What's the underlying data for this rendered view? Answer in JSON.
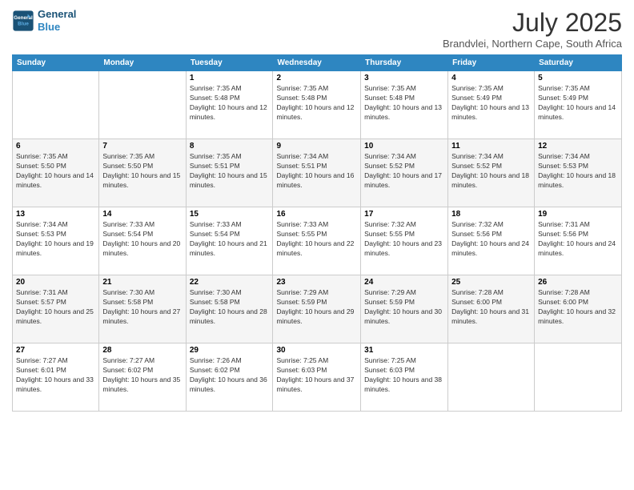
{
  "header": {
    "logo_line1": "General",
    "logo_line2": "Blue",
    "month_title": "July 2025",
    "location": "Brandvlei, Northern Cape, South Africa"
  },
  "weekdays": [
    "Sunday",
    "Monday",
    "Tuesday",
    "Wednesday",
    "Thursday",
    "Friday",
    "Saturday"
  ],
  "weeks": [
    [
      {
        "day": null
      },
      {
        "day": null
      },
      {
        "day": "1",
        "sunrise": "Sunrise: 7:35 AM",
        "sunset": "Sunset: 5:48 PM",
        "daylight": "Daylight: 10 hours and 12 minutes."
      },
      {
        "day": "2",
        "sunrise": "Sunrise: 7:35 AM",
        "sunset": "Sunset: 5:48 PM",
        "daylight": "Daylight: 10 hours and 12 minutes."
      },
      {
        "day": "3",
        "sunrise": "Sunrise: 7:35 AM",
        "sunset": "Sunset: 5:48 PM",
        "daylight": "Daylight: 10 hours and 13 minutes."
      },
      {
        "day": "4",
        "sunrise": "Sunrise: 7:35 AM",
        "sunset": "Sunset: 5:49 PM",
        "daylight": "Daylight: 10 hours and 13 minutes."
      },
      {
        "day": "5",
        "sunrise": "Sunrise: 7:35 AM",
        "sunset": "Sunset: 5:49 PM",
        "daylight": "Daylight: 10 hours and 14 minutes."
      }
    ],
    [
      {
        "day": "6",
        "sunrise": "Sunrise: 7:35 AM",
        "sunset": "Sunset: 5:50 PM",
        "daylight": "Daylight: 10 hours and 14 minutes."
      },
      {
        "day": "7",
        "sunrise": "Sunrise: 7:35 AM",
        "sunset": "Sunset: 5:50 PM",
        "daylight": "Daylight: 10 hours and 15 minutes."
      },
      {
        "day": "8",
        "sunrise": "Sunrise: 7:35 AM",
        "sunset": "Sunset: 5:51 PM",
        "daylight": "Daylight: 10 hours and 15 minutes."
      },
      {
        "day": "9",
        "sunrise": "Sunrise: 7:34 AM",
        "sunset": "Sunset: 5:51 PM",
        "daylight": "Daylight: 10 hours and 16 minutes."
      },
      {
        "day": "10",
        "sunrise": "Sunrise: 7:34 AM",
        "sunset": "Sunset: 5:52 PM",
        "daylight": "Daylight: 10 hours and 17 minutes."
      },
      {
        "day": "11",
        "sunrise": "Sunrise: 7:34 AM",
        "sunset": "Sunset: 5:52 PM",
        "daylight": "Daylight: 10 hours and 18 minutes."
      },
      {
        "day": "12",
        "sunrise": "Sunrise: 7:34 AM",
        "sunset": "Sunset: 5:53 PM",
        "daylight": "Daylight: 10 hours and 18 minutes."
      }
    ],
    [
      {
        "day": "13",
        "sunrise": "Sunrise: 7:34 AM",
        "sunset": "Sunset: 5:53 PM",
        "daylight": "Daylight: 10 hours and 19 minutes."
      },
      {
        "day": "14",
        "sunrise": "Sunrise: 7:33 AM",
        "sunset": "Sunset: 5:54 PM",
        "daylight": "Daylight: 10 hours and 20 minutes."
      },
      {
        "day": "15",
        "sunrise": "Sunrise: 7:33 AM",
        "sunset": "Sunset: 5:54 PM",
        "daylight": "Daylight: 10 hours and 21 minutes."
      },
      {
        "day": "16",
        "sunrise": "Sunrise: 7:33 AM",
        "sunset": "Sunset: 5:55 PM",
        "daylight": "Daylight: 10 hours and 22 minutes."
      },
      {
        "day": "17",
        "sunrise": "Sunrise: 7:32 AM",
        "sunset": "Sunset: 5:55 PM",
        "daylight": "Daylight: 10 hours and 23 minutes."
      },
      {
        "day": "18",
        "sunrise": "Sunrise: 7:32 AM",
        "sunset": "Sunset: 5:56 PM",
        "daylight": "Daylight: 10 hours and 24 minutes."
      },
      {
        "day": "19",
        "sunrise": "Sunrise: 7:31 AM",
        "sunset": "Sunset: 5:56 PM",
        "daylight": "Daylight: 10 hours and 24 minutes."
      }
    ],
    [
      {
        "day": "20",
        "sunrise": "Sunrise: 7:31 AM",
        "sunset": "Sunset: 5:57 PM",
        "daylight": "Daylight: 10 hours and 25 minutes."
      },
      {
        "day": "21",
        "sunrise": "Sunrise: 7:30 AM",
        "sunset": "Sunset: 5:58 PM",
        "daylight": "Daylight: 10 hours and 27 minutes."
      },
      {
        "day": "22",
        "sunrise": "Sunrise: 7:30 AM",
        "sunset": "Sunset: 5:58 PM",
        "daylight": "Daylight: 10 hours and 28 minutes."
      },
      {
        "day": "23",
        "sunrise": "Sunrise: 7:29 AM",
        "sunset": "Sunset: 5:59 PM",
        "daylight": "Daylight: 10 hours and 29 minutes."
      },
      {
        "day": "24",
        "sunrise": "Sunrise: 7:29 AM",
        "sunset": "Sunset: 5:59 PM",
        "daylight": "Daylight: 10 hours and 30 minutes."
      },
      {
        "day": "25",
        "sunrise": "Sunrise: 7:28 AM",
        "sunset": "Sunset: 6:00 PM",
        "daylight": "Daylight: 10 hours and 31 minutes."
      },
      {
        "day": "26",
        "sunrise": "Sunrise: 7:28 AM",
        "sunset": "Sunset: 6:00 PM",
        "daylight": "Daylight: 10 hours and 32 minutes."
      }
    ],
    [
      {
        "day": "27",
        "sunrise": "Sunrise: 7:27 AM",
        "sunset": "Sunset: 6:01 PM",
        "daylight": "Daylight: 10 hours and 33 minutes."
      },
      {
        "day": "28",
        "sunrise": "Sunrise: 7:27 AM",
        "sunset": "Sunset: 6:02 PM",
        "daylight": "Daylight: 10 hours and 35 minutes."
      },
      {
        "day": "29",
        "sunrise": "Sunrise: 7:26 AM",
        "sunset": "Sunset: 6:02 PM",
        "daylight": "Daylight: 10 hours and 36 minutes."
      },
      {
        "day": "30",
        "sunrise": "Sunrise: 7:25 AM",
        "sunset": "Sunset: 6:03 PM",
        "daylight": "Daylight: 10 hours and 37 minutes."
      },
      {
        "day": "31",
        "sunrise": "Sunrise: 7:25 AM",
        "sunset": "Sunset: 6:03 PM",
        "daylight": "Daylight: 10 hours and 38 minutes."
      },
      {
        "day": null
      },
      {
        "day": null
      }
    ]
  ]
}
